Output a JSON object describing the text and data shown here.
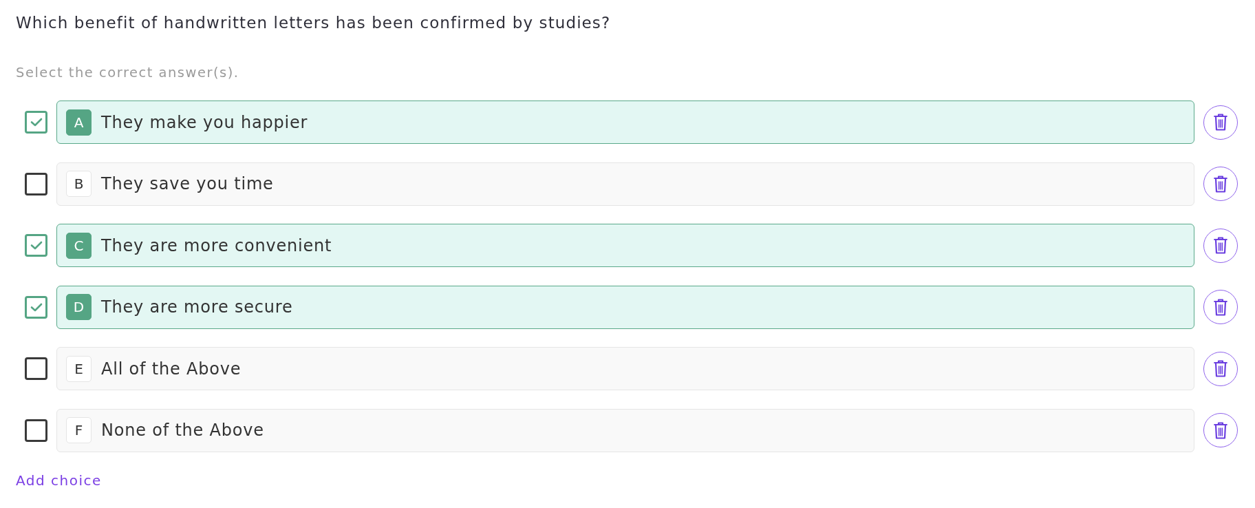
{
  "question": {
    "text": "Which benefit of handwritten letters has been confirmed by studies?"
  },
  "instruction": "Select the correct answer(s).",
  "choices": [
    {
      "letter": "A",
      "text": "They make you happier",
      "checked": true
    },
    {
      "letter": "B",
      "text": "They save you time",
      "checked": false
    },
    {
      "letter": "C",
      "text": "They are more convenient",
      "checked": true
    },
    {
      "letter": "D",
      "text": "They are more secure",
      "checked": true
    },
    {
      "letter": "E",
      "text": "All of the Above",
      "checked": false
    },
    {
      "letter": "F",
      "text": "None of the Above",
      "checked": false
    }
  ],
  "add_choice": {
    "label": "Add choice"
  }
}
